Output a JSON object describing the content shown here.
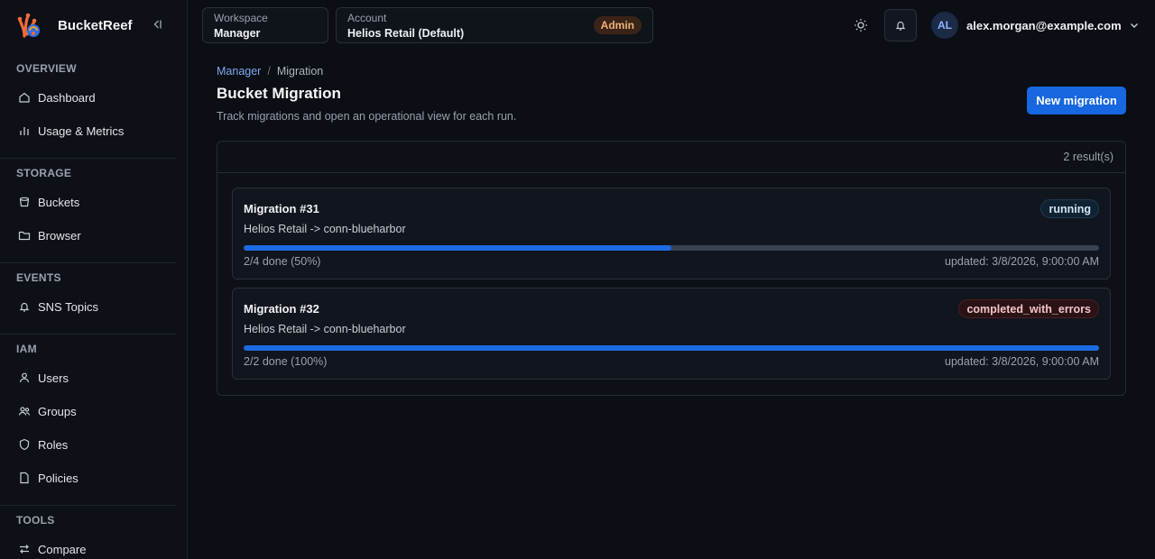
{
  "brand": {
    "name": "BucketReef"
  },
  "sidebar": {
    "sections": [
      {
        "title": "OVERVIEW",
        "items": [
          {
            "label": "Dashboard",
            "icon": "home-icon"
          },
          {
            "label": "Usage & Metrics",
            "icon": "bar-chart-icon"
          }
        ]
      },
      {
        "title": "STORAGE",
        "items": [
          {
            "label": "Buckets",
            "icon": "bucket-icon"
          },
          {
            "label": "Browser",
            "icon": "folder-icon"
          }
        ]
      },
      {
        "title": "EVENTS",
        "items": [
          {
            "label": "SNS Topics",
            "icon": "bell-icon"
          }
        ]
      },
      {
        "title": "IAM",
        "items": [
          {
            "label": "Users",
            "icon": "user-icon"
          },
          {
            "label": "Groups",
            "icon": "users-icon"
          },
          {
            "label": "Roles",
            "icon": "shield-icon"
          },
          {
            "label": "Policies",
            "icon": "file-icon"
          }
        ]
      },
      {
        "title": "TOOLS",
        "items": [
          {
            "label": "Compare",
            "icon": "compare-icon"
          }
        ]
      }
    ]
  },
  "header": {
    "workspace": {
      "label": "Workspace",
      "value": "Manager"
    },
    "account": {
      "label": "Account",
      "value": "Helios Retail (Default)",
      "role": "Admin"
    },
    "user": {
      "initials": "AL",
      "email": "alex.morgan@example.com"
    }
  },
  "breadcrumb": {
    "parent": "Manager",
    "separator": "/",
    "current": "Migration"
  },
  "page": {
    "title": "Bucket Migration",
    "subtitle": "Track migrations and open an operational view for each run.",
    "new_button": "New migration",
    "result_count": "2 result(s)"
  },
  "migrations": [
    {
      "title": "Migration #31",
      "route": "Helios Retail -> conn-blueharbor",
      "status": "running",
      "progress_fraction": 0.5,
      "done_text": "2/4 done (50%)",
      "updated": "updated: 3/8/2026, 9:00:00 AM"
    },
    {
      "title": "Migration #32",
      "route": "Helios Retail -> conn-blueharbor",
      "status": "completed_with_errors",
      "progress_fraction": 1.0,
      "done_text": "2/2 done (100%)",
      "updated": "updated: 3/8/2026, 9:00:00 AM"
    }
  ],
  "colors": {
    "accent": "#1767e0",
    "progress": "#1d6be3",
    "admin_badge": "#f0b07a"
  }
}
